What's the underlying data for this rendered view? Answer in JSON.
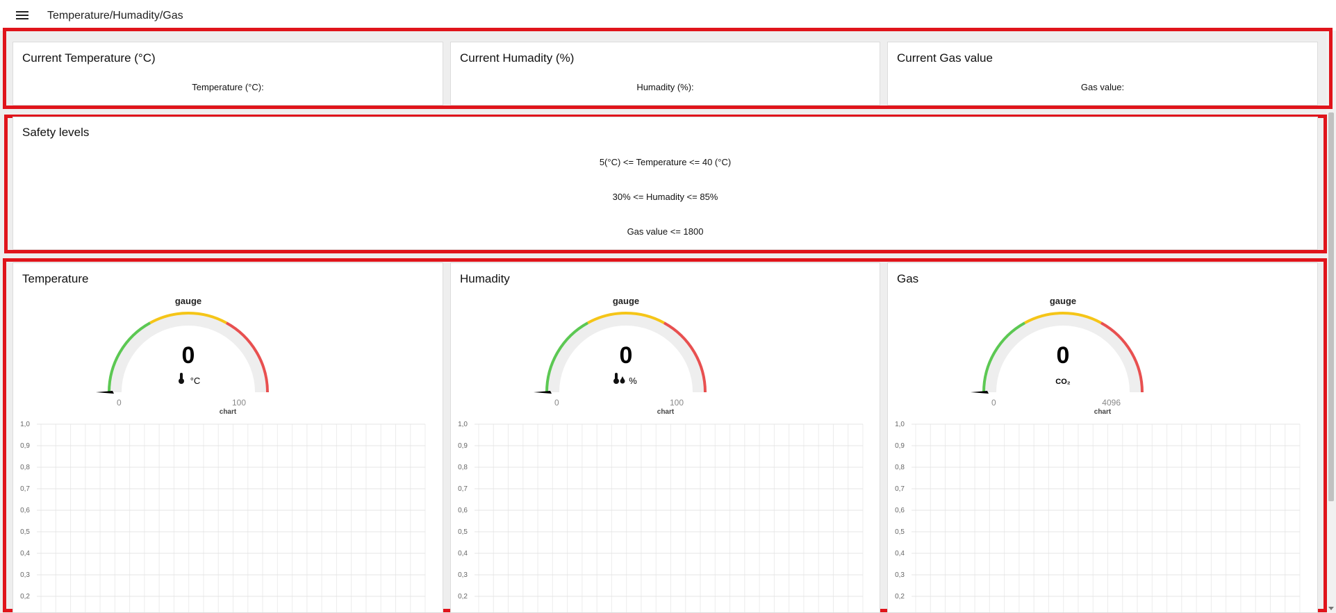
{
  "header": {
    "title": "Temperature/Humadity/Gas",
    "menu_icon": "hamburger-menu-icon"
  },
  "current": [
    {
      "title": "Current Temperature (°C)",
      "label": "Temperature (°C):"
    },
    {
      "title": "Current Humadity (%)",
      "label": "Humadity (%):"
    },
    {
      "title": "Current Gas value",
      "label": "Gas value:"
    }
  ],
  "safety": {
    "title": "Safety levels",
    "lines": [
      "5(°C) <= Temperature <= 40 (°C)",
      "30% <= Humadity <= 85%",
      "Gas value <= 1800"
    ]
  },
  "gauges": [
    {
      "title": "Temperature",
      "gauge_label": "gauge",
      "value": "0",
      "unit": "°C",
      "min": "0",
      "max": "100",
      "icon": "thermometer-icon",
      "chart_label": "chart"
    },
    {
      "title": "Humadity",
      "gauge_label": "gauge",
      "value": "0",
      "unit": "%",
      "min": "0",
      "max": "100",
      "icon": "thermometer-drops-icon",
      "chart_label": "chart"
    },
    {
      "title": "Gas",
      "gauge_label": "gauge",
      "value": "0",
      "unit": "CO₂",
      "min": "0",
      "max": "4096",
      "icon": "co2-icon",
      "chart_label": "chart"
    }
  ],
  "colors": {
    "highlight": "#e0141b",
    "green": "#5cc853",
    "yellow": "#f5c518",
    "red": "#e85050"
  },
  "chart_data": [
    {
      "type": "line",
      "series": [],
      "yticks": [
        "1,0",
        "0,9",
        "0,8",
        "0,7",
        "0,6",
        "0,5",
        "0,4",
        "0,3",
        "0,2"
      ],
      "ylim": [
        0.2,
        1.0
      ],
      "grid": true
    },
    {
      "type": "line",
      "series": [],
      "yticks": [
        "1,0",
        "0,9",
        "0,8",
        "0,7",
        "0,6",
        "0,5",
        "0,4",
        "0,3",
        "0,2"
      ],
      "ylim": [
        0.2,
        1.0
      ],
      "grid": true
    },
    {
      "type": "line",
      "series": [],
      "yticks": [
        "1,0",
        "0,9",
        "0,8",
        "0,7",
        "0,6",
        "0,5",
        "0,4",
        "0,3",
        "0,2"
      ],
      "ylim": [
        0.2,
        1.0
      ],
      "grid": true
    }
  ]
}
